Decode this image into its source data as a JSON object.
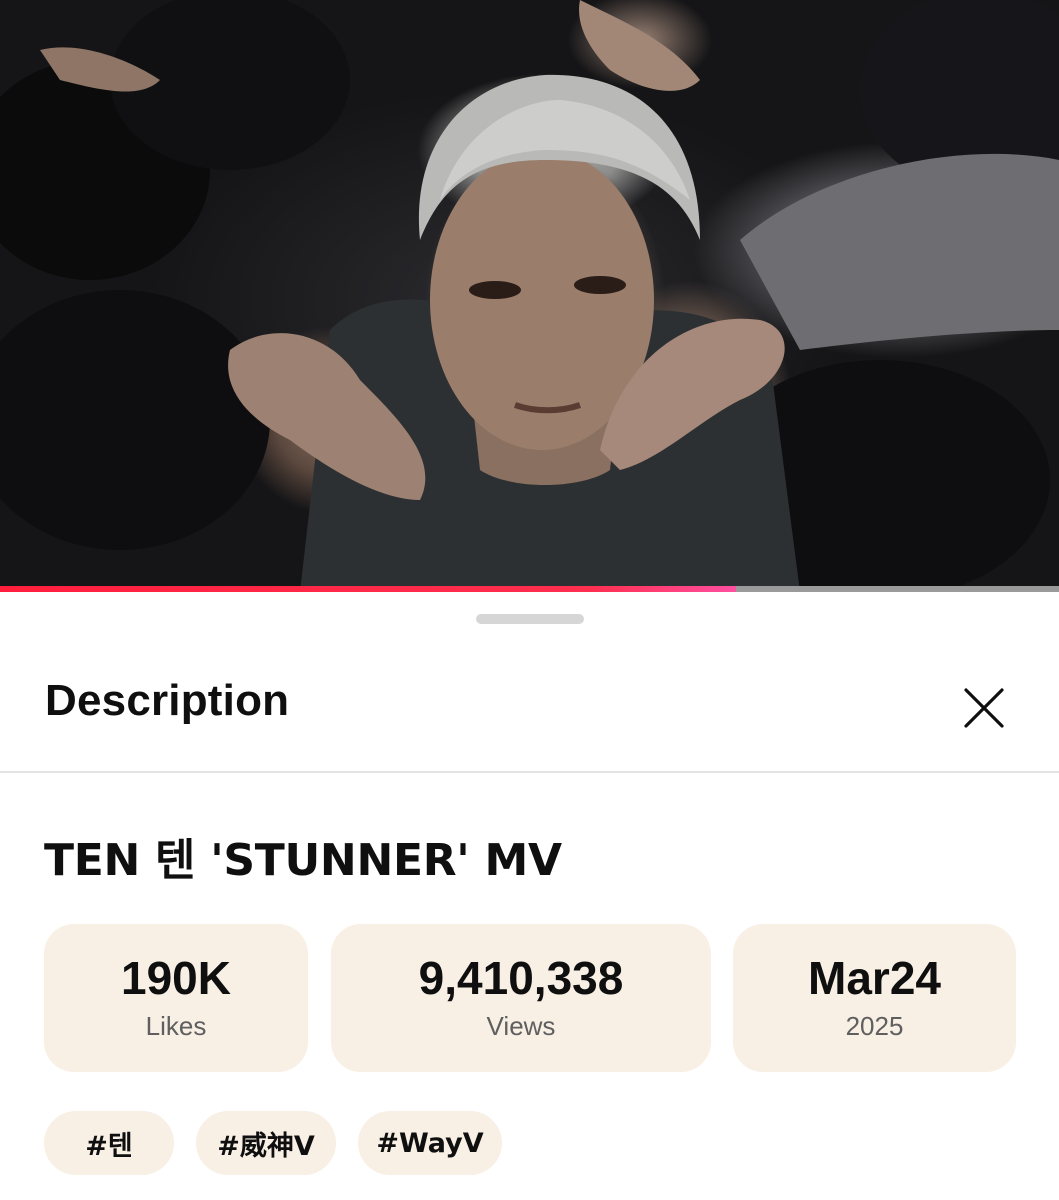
{
  "player": {
    "progress_fraction": 0.695,
    "colors": {
      "progress": "#ff1f3d",
      "track": "#9a9a9a"
    }
  },
  "sheet": {
    "title": "Description",
    "close_icon": "close-icon"
  },
  "video": {
    "title": "TEN 텐 'STUNNER' MV"
  },
  "stats": [
    {
      "value": "190K",
      "label": "Likes"
    },
    {
      "value": "9,410,338",
      "label": "Views"
    },
    {
      "value": "Mar24",
      "label": "2025"
    }
  ],
  "hashtags": [
    "#텐",
    "#威神V",
    "#WayV"
  ],
  "colors": {
    "chip_background": "#f8efe5",
    "text": "#0f0f0f",
    "muted": "#5f5f5f"
  }
}
